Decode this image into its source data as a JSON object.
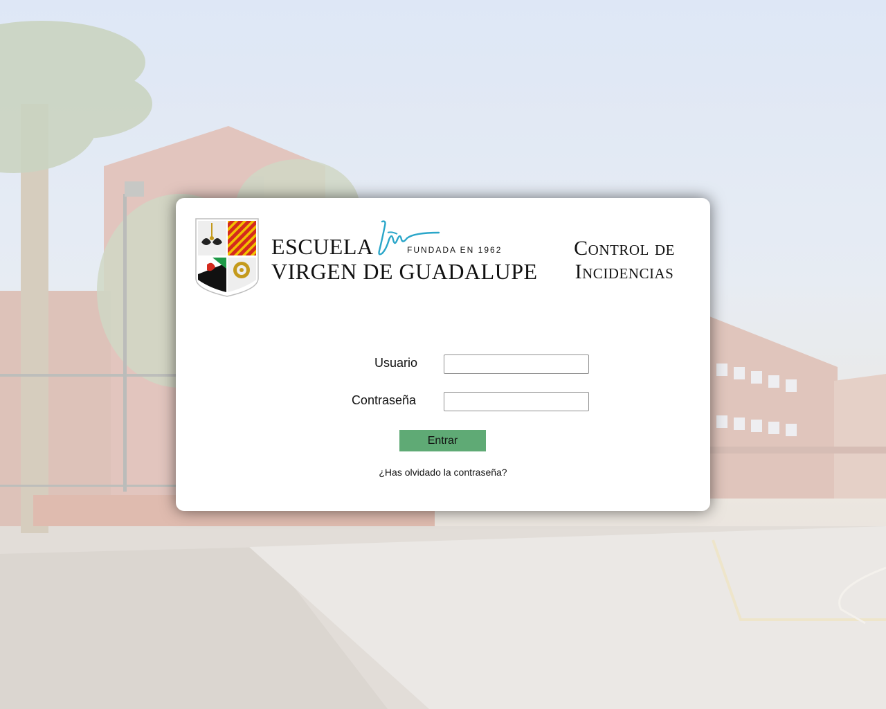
{
  "school": {
    "line1": "ESCUELA",
    "line2": "VIRGEN DE GUADALUPE",
    "founded": "FUNDADA EN 1962"
  },
  "app": {
    "title_line1": "Control de",
    "title_line2": "Incidencias"
  },
  "form": {
    "user_label": "Usuario",
    "user_value": "",
    "password_label": "Contraseña",
    "password_value": "",
    "submit_label": "Entrar",
    "forgot_link": "¿Has olvidado la contraseña?"
  },
  "colors": {
    "button": "#5faa75",
    "signature": "#2aa6c9",
    "crest_red": "#d42a1e",
    "crest_yellow": "#f2c200",
    "crest_green": "#1e9a48"
  },
  "icons": {
    "crest": "school-crest-icon",
    "signature": "founder-signature-icon"
  }
}
